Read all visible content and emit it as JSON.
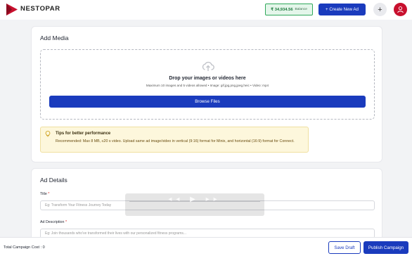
{
  "header": {
    "brand": "NESTOPAR",
    "balance_amount": "₹ 34,934.56",
    "balance_label": "Balance",
    "create_button": "+ Create New Ad",
    "add_icon": "plus-icon",
    "avatar_icon": "user-avatar-icon"
  },
  "add_media": {
    "title": "Add Media",
    "drop_title": "Drop your images or videos here",
    "drop_subtitle": "Maximum 10 images and 5 videos allowed • Image: gif,jpg,png,jpeg,heic • Video: mp4",
    "browse_button": "Browse Files",
    "upload_icon": "upload-icon"
  },
  "tips": {
    "title": "Tips for better performance",
    "body": "Recommended: Max 8 MB, ≤20 s video. Upload same ad image/video in vertical (9:16) format for Minix, and horizontal (16:9) format for Connect.",
    "icon": "lightbulb-icon"
  },
  "ad_details": {
    "title": "Ad Details",
    "title_label": "Title",
    "title_placeholder": "Eg: Transform Your Fitness Journey Today",
    "description_label": "Ad Description",
    "description_placeholder": "Eg: Join thousands who've transformed their lives with our personalized fitness programs..."
  },
  "required_marker": "*",
  "footer": {
    "total_cost": "Total Campaign Cost : 0",
    "save_draft": "Save Draft",
    "publish": "Publish Campaign"
  },
  "colors": {
    "primary": "#1a3bbd",
    "balance_bg": "#e4f6ea",
    "balance_border": "#2fa85a",
    "tips_bg": "#fdf7dc",
    "brand_red": "#c8102e"
  }
}
